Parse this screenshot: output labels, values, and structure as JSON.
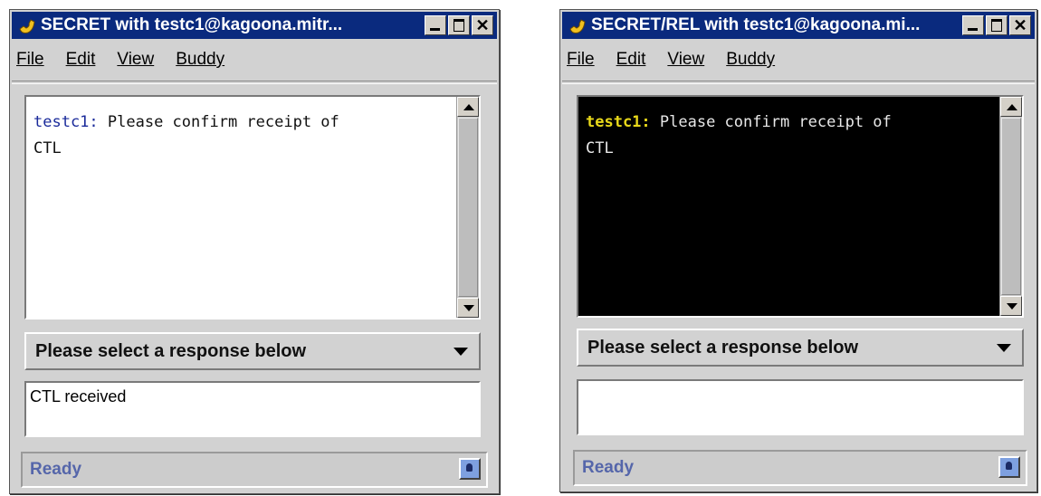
{
  "windows": [
    {
      "title": "SECRET with testc1@kagoona.mitr...",
      "menu": [
        "File",
        "Edit",
        "View",
        "Buddy"
      ],
      "message": {
        "sender": "testc1:",
        "line1": " Please confirm receipt of",
        "line2": "CTL"
      },
      "colors": {
        "background": "#ffffff",
        "sender": "#1a2a9a",
        "text": "#111111"
      },
      "response_select": "Please select a response below",
      "input_value": "CTL received",
      "status": "Ready"
    },
    {
      "title": "SECRET/REL with testc1@kagoona.mi...",
      "menu": [
        "File",
        "Edit",
        "View",
        "Buddy"
      ],
      "message": {
        "sender": "testc1:",
        "line1": " Please confirm receipt of",
        "line2": "CTL"
      },
      "colors": {
        "background": "#000000",
        "sender": "#e8d81a",
        "text": "#e8e8e8"
      },
      "response_select": "Please select a response below",
      "input_value": "",
      "status": "Ready"
    }
  ],
  "icons": {
    "app": "phone-handset-icon",
    "minimize": "minimize-icon",
    "maximize": "maximize-icon",
    "close": "close-icon",
    "scroll_up": "scroll-up-icon",
    "scroll_down": "scroll-down-icon",
    "dropdown": "chevron-down-icon",
    "status": "buddy-status-icon"
  }
}
